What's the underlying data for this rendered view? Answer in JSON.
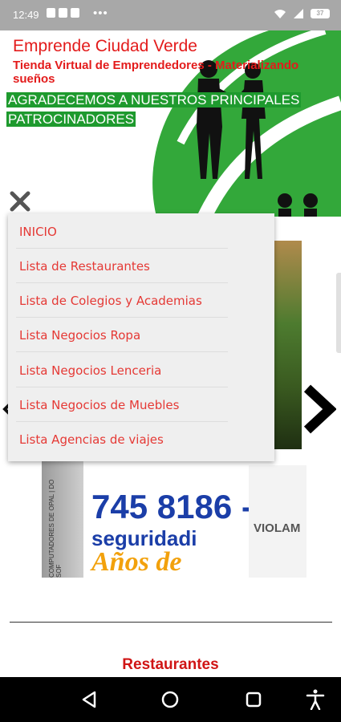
{
  "status_bar": {
    "time": "12:49",
    "battery": "37"
  },
  "header": {
    "title": "Emprende Ciudad Verde",
    "subtitle": "Tienda Virtual de Emprendedores - Materializando sueños",
    "sponsor_line_1": "AGRADECEMOS A NUESTROS PRINCIPALES",
    "sponsor_line_2": "PATROCINADORES"
  },
  "menu": {
    "items": [
      {
        "label": "INICIO"
      },
      {
        "label": "Lista de Restaurantes"
      },
      {
        "label": "Lista de Colegios y Academias"
      },
      {
        "label": "Lista Negocios Ropa"
      },
      {
        "label": "Lista Negocios Lenceria"
      },
      {
        "label": "Lista Negocios de Muebles"
      },
      {
        "label": "Lista Agencias de viajes"
      }
    ]
  },
  "ad": {
    "phone": "745 8186 -",
    "line2": "seguridadi",
    "line3": "Años de",
    "brand": "VIOLAM",
    "side_text": "COMPUTADORES DE OPAL | DO SOF"
  },
  "section": {
    "title": "Restaurantes"
  },
  "colors": {
    "accent_red": "#e31b1b",
    "menu_text": "#e53935",
    "banner_green": "#1e9a2e",
    "leaf_green": "#33a83a"
  }
}
